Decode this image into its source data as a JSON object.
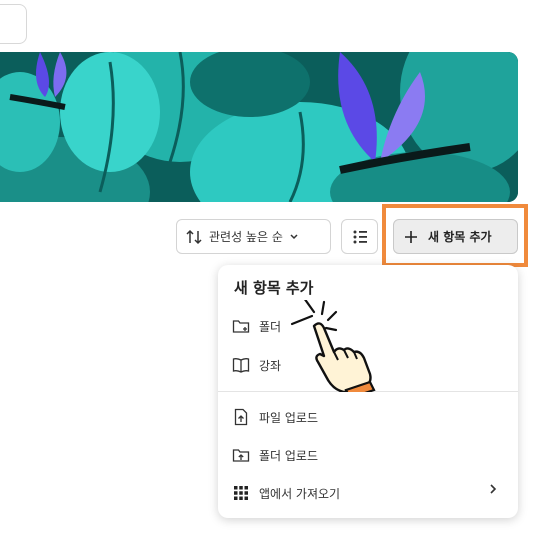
{
  "toolbar": {
    "sort_label": "관련성 높은 순",
    "add_label": "새 항목 추가"
  },
  "menu": {
    "title": "새 항목 추가",
    "items": [
      {
        "label": "폴더",
        "icon": "folder-plus-icon"
      },
      {
        "label": "강좌",
        "icon": "book-open-icon"
      },
      {
        "label": "파일 업로드",
        "icon": "file-upload-icon"
      },
      {
        "label": "폴더 업로드",
        "icon": "folder-upload-icon"
      },
      {
        "label": "앱에서 가져오기",
        "icon": "apps-grid-icon"
      }
    ]
  },
  "colors": {
    "highlight": "#f08a3c",
    "banner_teal": "#2ec9c1",
    "banner_blue": "#5b49e6",
    "hand_fill": "#fff3d6"
  }
}
